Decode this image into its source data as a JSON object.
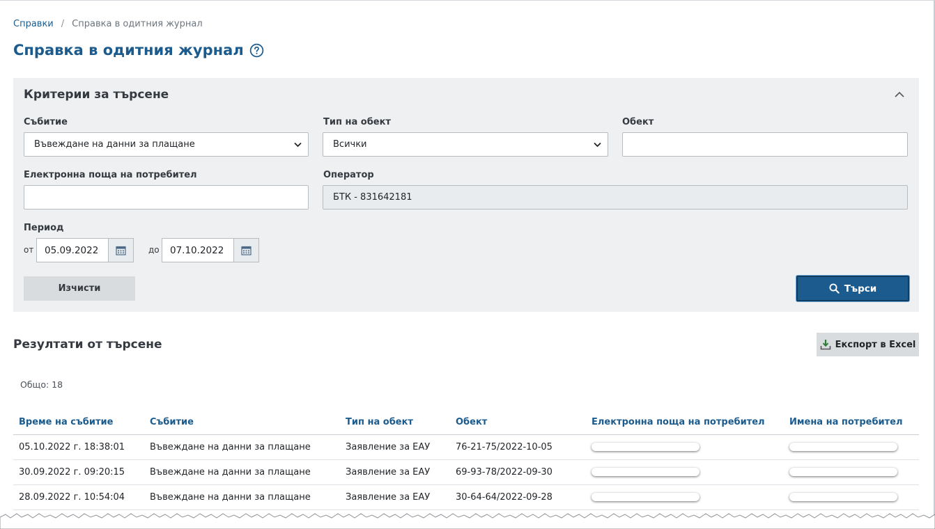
{
  "breadcrumb": {
    "root": "Справки",
    "current": "Справка в одитния журнал"
  },
  "page": {
    "title": "Справка в одитния журнал"
  },
  "criteria": {
    "title": "Критерии за търсене",
    "event_label": "Събитие",
    "event_value": "Въвеждане на данни за плащане",
    "object_type_label": "Тип на обект",
    "object_type_value": "Всички",
    "object_label": "Обект",
    "object_value": "",
    "email_label": "Електронна поща на потребител",
    "email_value": "",
    "operator_label": "Оператор",
    "operator_value": "БТК - 831642181",
    "period_label": "Период",
    "from_label": "от",
    "from_value": "05.09.2022",
    "to_label": "до",
    "to_value": "07.10.2022",
    "clear_label": "Изчисти",
    "search_label": "Търси"
  },
  "results": {
    "title": "Резултати от търсене",
    "export_label": "Експорт в Excel",
    "total": "Общо: 18",
    "columns": [
      "Време на събитие",
      "Събитие",
      "Тип на обект",
      "Обект",
      "Електронна поща на потребител",
      "Имена на потребител"
    ],
    "rows": [
      [
        "05.10.2022 г. 18:38:01",
        "Въвеждане на данни за плащане",
        "Заявление за ЕАУ",
        "76-21-75/2022-10-05"
      ],
      [
        "30.09.2022 г. 09:20:15",
        "Въвеждане на данни за плащане",
        "Заявление за ЕАУ",
        "69-93-78/2022-09-30"
      ],
      [
        "28.09.2022 г. 10:54:04",
        "Въвеждане на данни за плащане",
        "Заявление за ЕАУ",
        "30-64-64/2022-09-28"
      ]
    ]
  },
  "colors": {
    "primary": "#1b5b8e",
    "panel": "#eef0f2",
    "button_gray": "#d9dcdf"
  },
  "icons": {
    "help": "question-circle-icon",
    "collapse": "chevron-up-icon",
    "calendar": "calendar-icon",
    "search": "search-icon",
    "export": "download-icon"
  }
}
